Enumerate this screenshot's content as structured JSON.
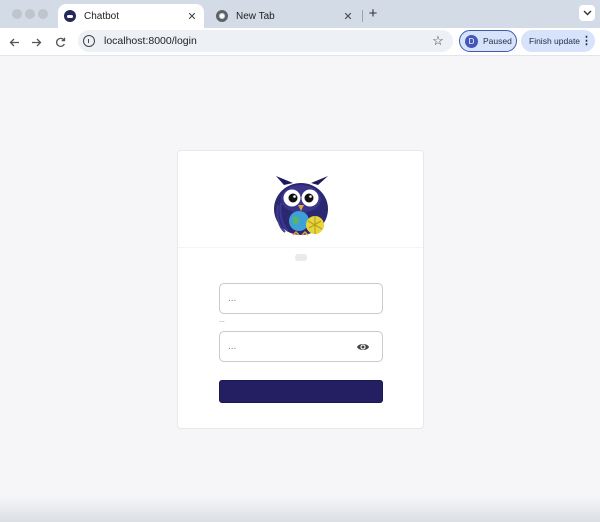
{
  "browser": {
    "tabs": [
      {
        "title": "Chatbot",
        "close": "✕"
      },
      {
        "title": "New Tab",
        "close": "✕"
      }
    ],
    "new_tab": "+",
    "address": "localhost:8000/login",
    "profile": {
      "initial": "D",
      "label": "Paused"
    },
    "update_label": "Finish update",
    "more": "⋮",
    "bookmark_glyph": "☆",
    "icons": {
      "back": "arrow-left-icon",
      "forward": "arrow-right-icon",
      "reload": "reload-icon",
      "site_info": "info-icon",
      "tab_menu": "chevron-down-icon"
    }
  },
  "login": {
    "username_placeholder": "...",
    "field_label": "...",
    "password_placeholder": "...",
    "submit_label": ""
  },
  "colors": {
    "brand": "#241f63",
    "tabstrip": "#d3dbe6",
    "chip": "#d7e3fb",
    "page_bg": "#f6f6f8"
  }
}
